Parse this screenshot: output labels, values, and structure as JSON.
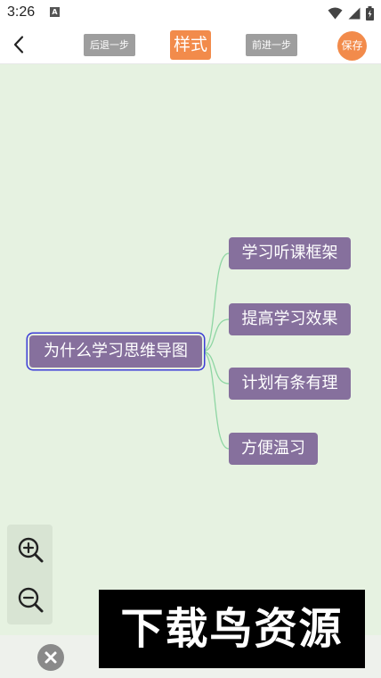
{
  "status_bar": {
    "time": "3:26",
    "notification_badge": "A"
  },
  "toolbar": {
    "undo_label": "后退一步",
    "style_label": "样式",
    "redo_label": "前进一步",
    "save_label": "保存"
  },
  "mindmap": {
    "root": "为什么学习思维导图",
    "children": [
      "学习听课框架",
      "提高学习效果",
      "计划有条有理",
      "方便温习"
    ]
  },
  "watermark": {
    "text": "下载鸟资源"
  },
  "colors": {
    "node_fill": "#86709d",
    "canvas_bg": "#e6f2e1",
    "accent": "#f28b4b",
    "connector": "#8ed6a3",
    "selection": "#3d3dd6"
  }
}
